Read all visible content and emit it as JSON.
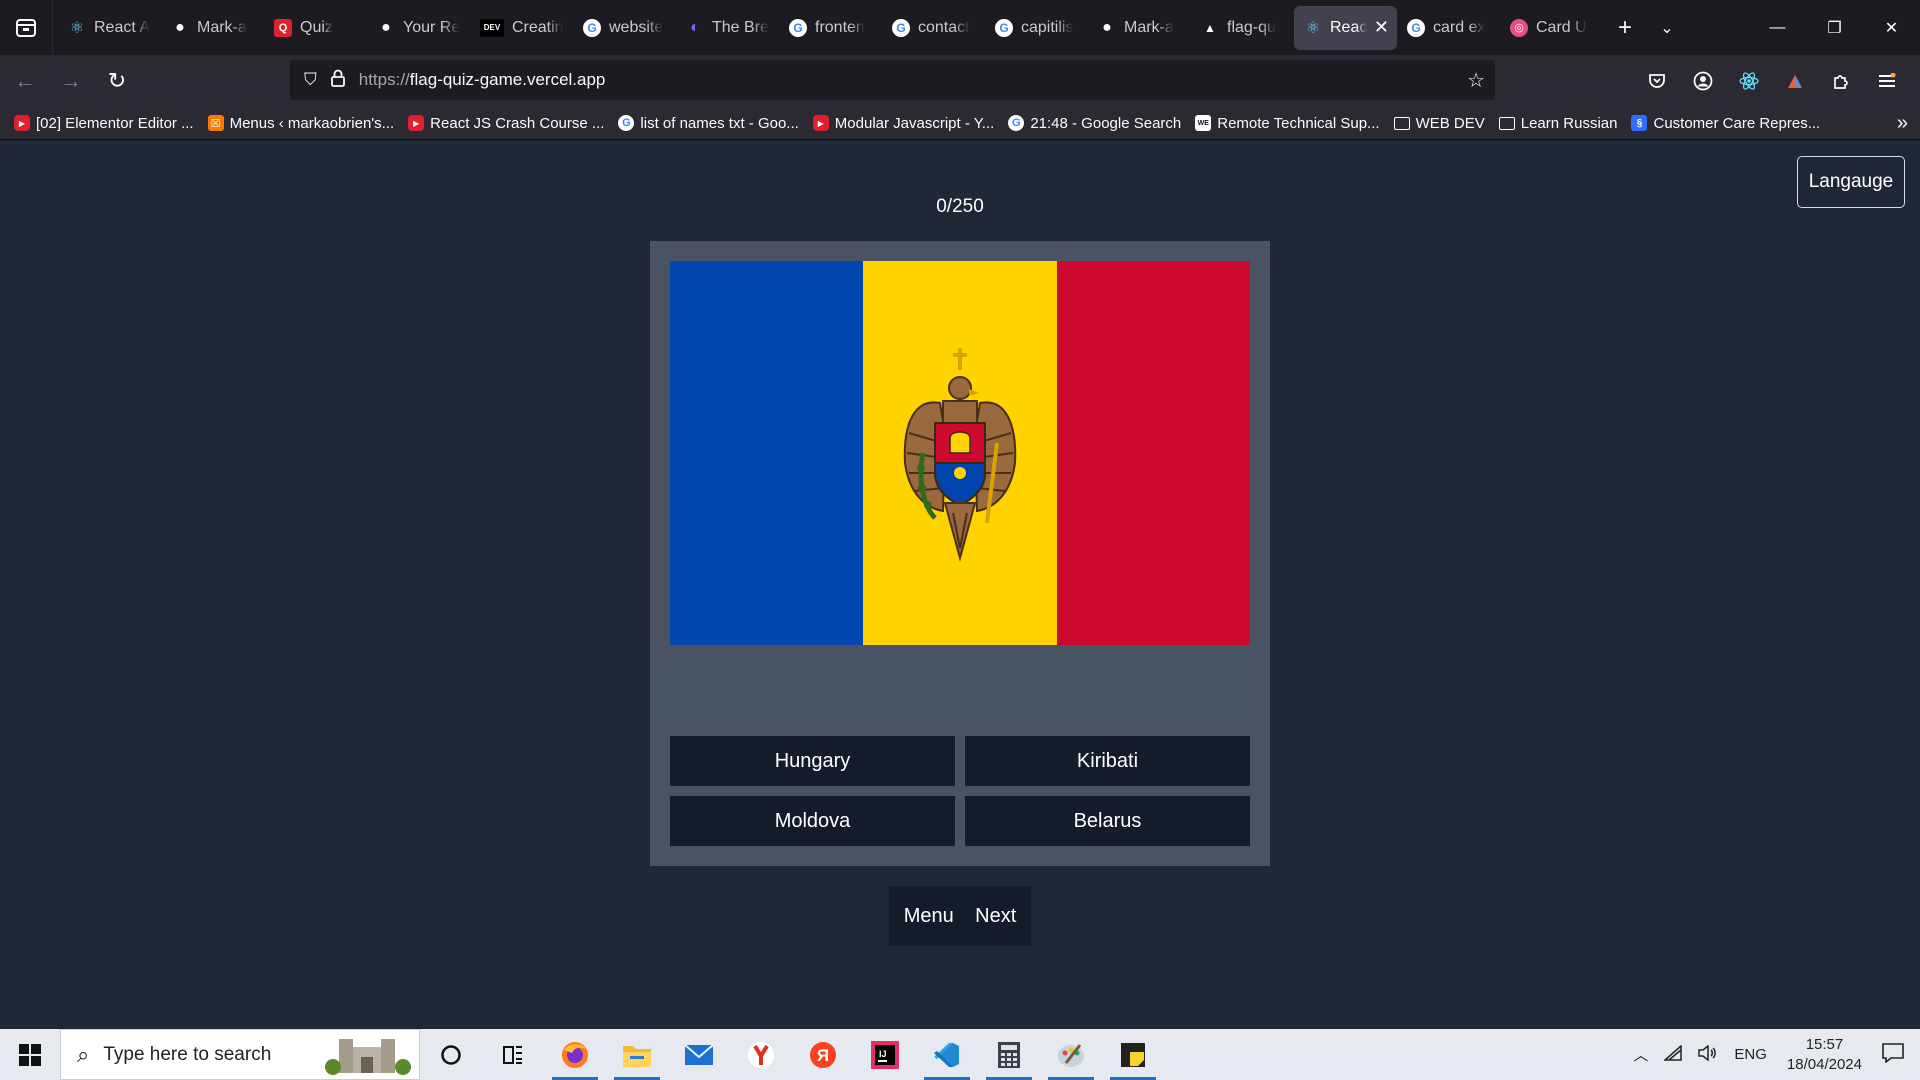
{
  "browser": {
    "tabs": [
      {
        "title": "React A",
        "icon": "react-icon",
        "color": "#61dafb"
      },
      {
        "title": "Mark-a",
        "icon": "github-icon",
        "color": "#ffffff"
      },
      {
        "title": "Quiz",
        "icon": "quiz-icon",
        "color": "#e0202f"
      },
      {
        "title": "Your Re",
        "icon": "github-icon",
        "color": "#ffffff"
      },
      {
        "title": "Creatin",
        "icon": "dev-icon",
        "color": "#000000"
      },
      {
        "title": "website",
        "icon": "google-icon",
        "color": "#ffffff"
      },
      {
        "title": "The Bre",
        "icon": "breakpoint-icon",
        "color": "#3b3bdb"
      },
      {
        "title": "fronten",
        "icon": "google-icon",
        "color": "#ffffff"
      },
      {
        "title": "contact",
        "icon": "google-icon",
        "color": "#ffffff"
      },
      {
        "title": "capitilis",
        "icon": "google-icon",
        "color": "#ffffff"
      },
      {
        "title": "Mark-a",
        "icon": "github-icon",
        "color": "#ffffff"
      },
      {
        "title": "flag-qu",
        "icon": "vercel-icon",
        "color": "#ffffff"
      },
      {
        "title": "Reac",
        "icon": "react-icon",
        "color": "#61dafb",
        "active": true
      },
      {
        "title": "card ex",
        "icon": "google-icon",
        "color": "#ffffff"
      },
      {
        "title": "Card U",
        "icon": "dribbble-icon",
        "color": "#ea4c89"
      }
    ],
    "url_scheme": "https://",
    "url_host": "flag-quiz-game.vercel.app",
    "bookmarks": [
      {
        "label": "[02] Elementor Editor ...",
        "icon": "youtube-icon",
        "color": "#e0202f"
      },
      {
        "label": "Menus ‹ markaobrien's...",
        "icon": "xampp-icon",
        "color": "#f57c00"
      },
      {
        "label": "React JS Crash Course ...",
        "icon": "youtube-icon",
        "color": "#e0202f"
      },
      {
        "label": "list of names txt - Goo...",
        "icon": "google-icon",
        "color": "#ffffff"
      },
      {
        "label": "Modular Javascript - Y...",
        "icon": "youtube-icon",
        "color": "#e0202f"
      },
      {
        "label": "21:48 - Google Search",
        "icon": "google-icon",
        "color": "#ffffff"
      },
      {
        "label": "Remote Technical Sup...",
        "icon": "wwr-icon",
        "color": "#111111"
      },
      {
        "label": "WEB DEV",
        "icon": "folder-icon",
        "color": "#2b2a33"
      },
      {
        "label": "Learn Russian",
        "icon": "folder-icon",
        "color": "#2b2a33"
      },
      {
        "label": "Customer Care Repres...",
        "icon": "site-icon",
        "color": "#2f6fff"
      }
    ]
  },
  "page": {
    "language_button": "Langauge",
    "score": "0/250",
    "flag": {
      "colors": [
        "#0046ae",
        "#ffd200",
        "#cc092f"
      ]
    },
    "answers": [
      "Hungary",
      "Kiribati",
      "Moldova",
      "Belarus"
    ],
    "menu_button": "Menu",
    "next_button": "Next"
  },
  "taskbar": {
    "search_placeholder": "Type here to search",
    "language": "ENG",
    "time": "15:57",
    "date": "18/04/2024"
  }
}
